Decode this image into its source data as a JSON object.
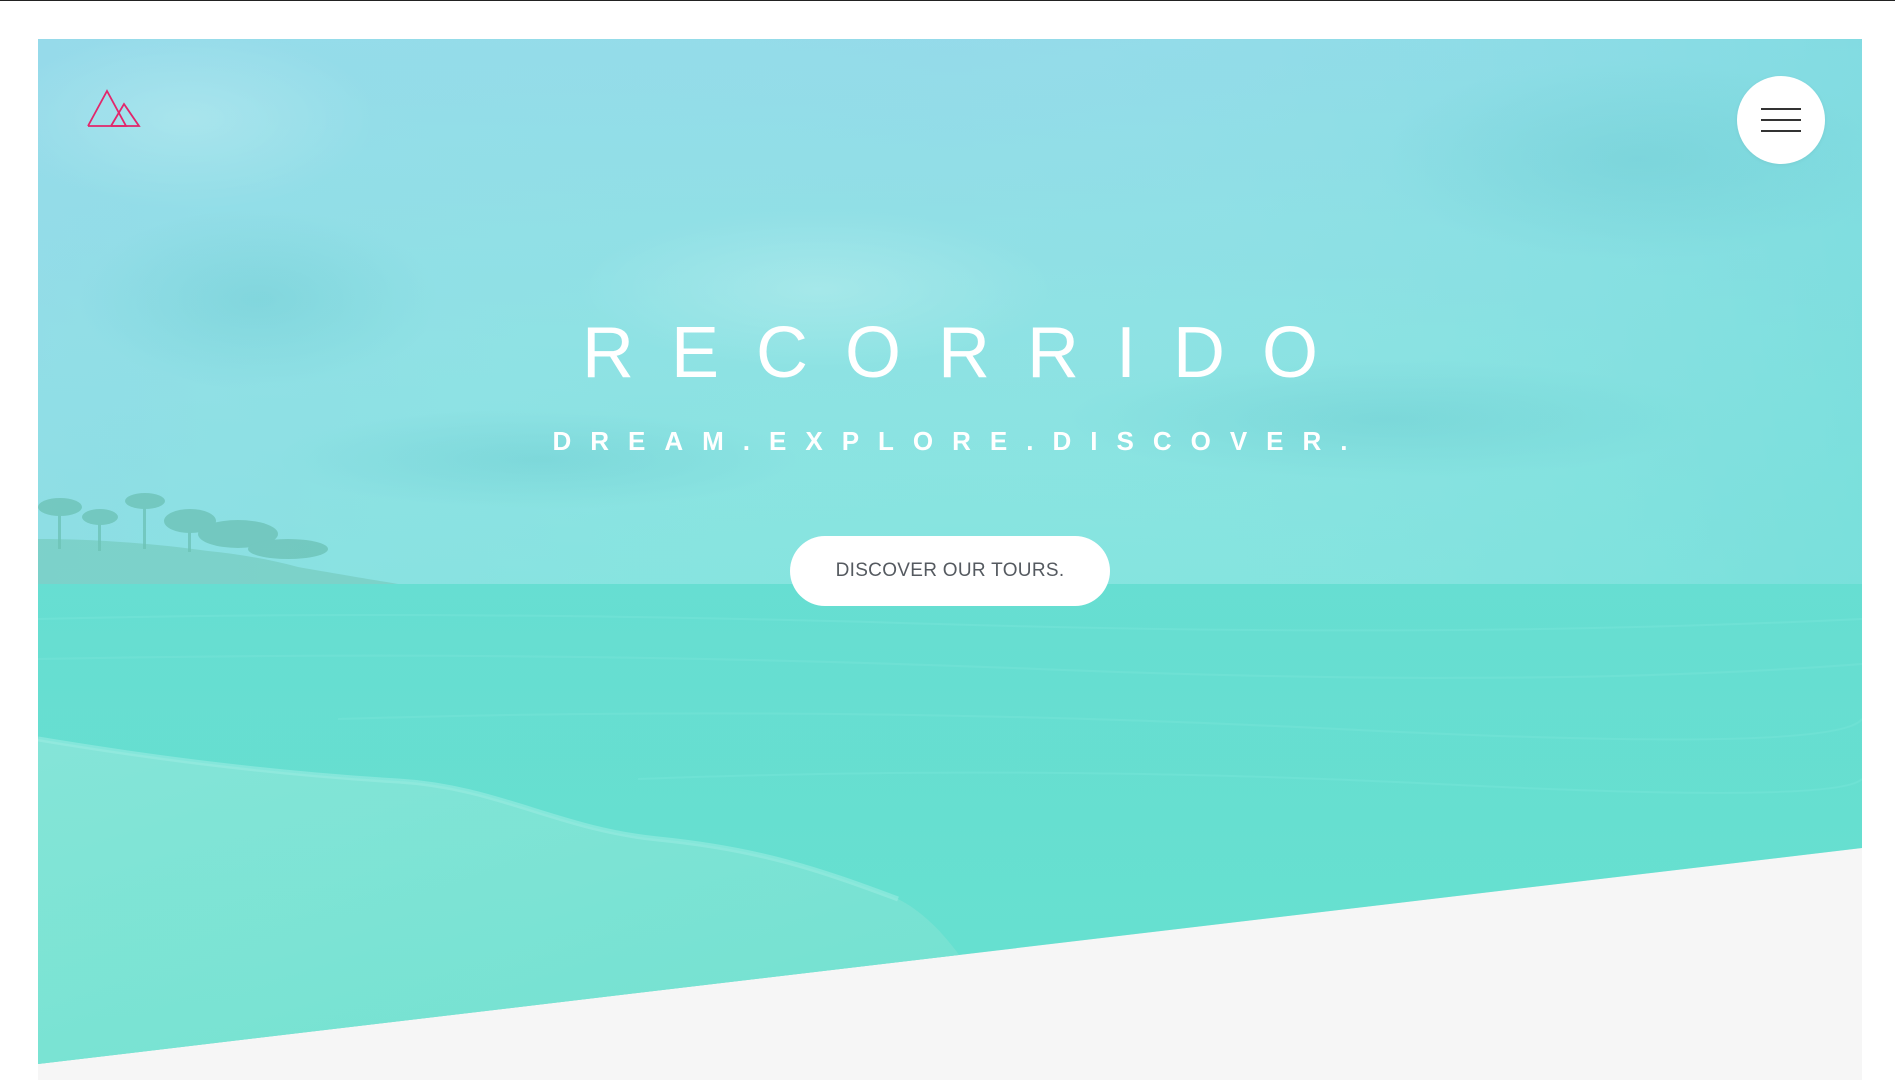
{
  "brand": {
    "logo_icon": "mountains-icon",
    "logo_color": "#e2266b"
  },
  "nav": {
    "menu_icon": "hamburger-menu-icon"
  },
  "hero": {
    "title": "RECORRIDO",
    "tagline": "DREAM.EXPLORE.DISCOVER.",
    "cta_label": "DISCOVER OUR TOURS.",
    "background": "beach-sea-photo"
  },
  "colors": {
    "overlay_accent": "#6fe0d8",
    "page_background": "#f6f6f6",
    "text_on_hero": "#ffffff",
    "button_text": "#555a60"
  }
}
